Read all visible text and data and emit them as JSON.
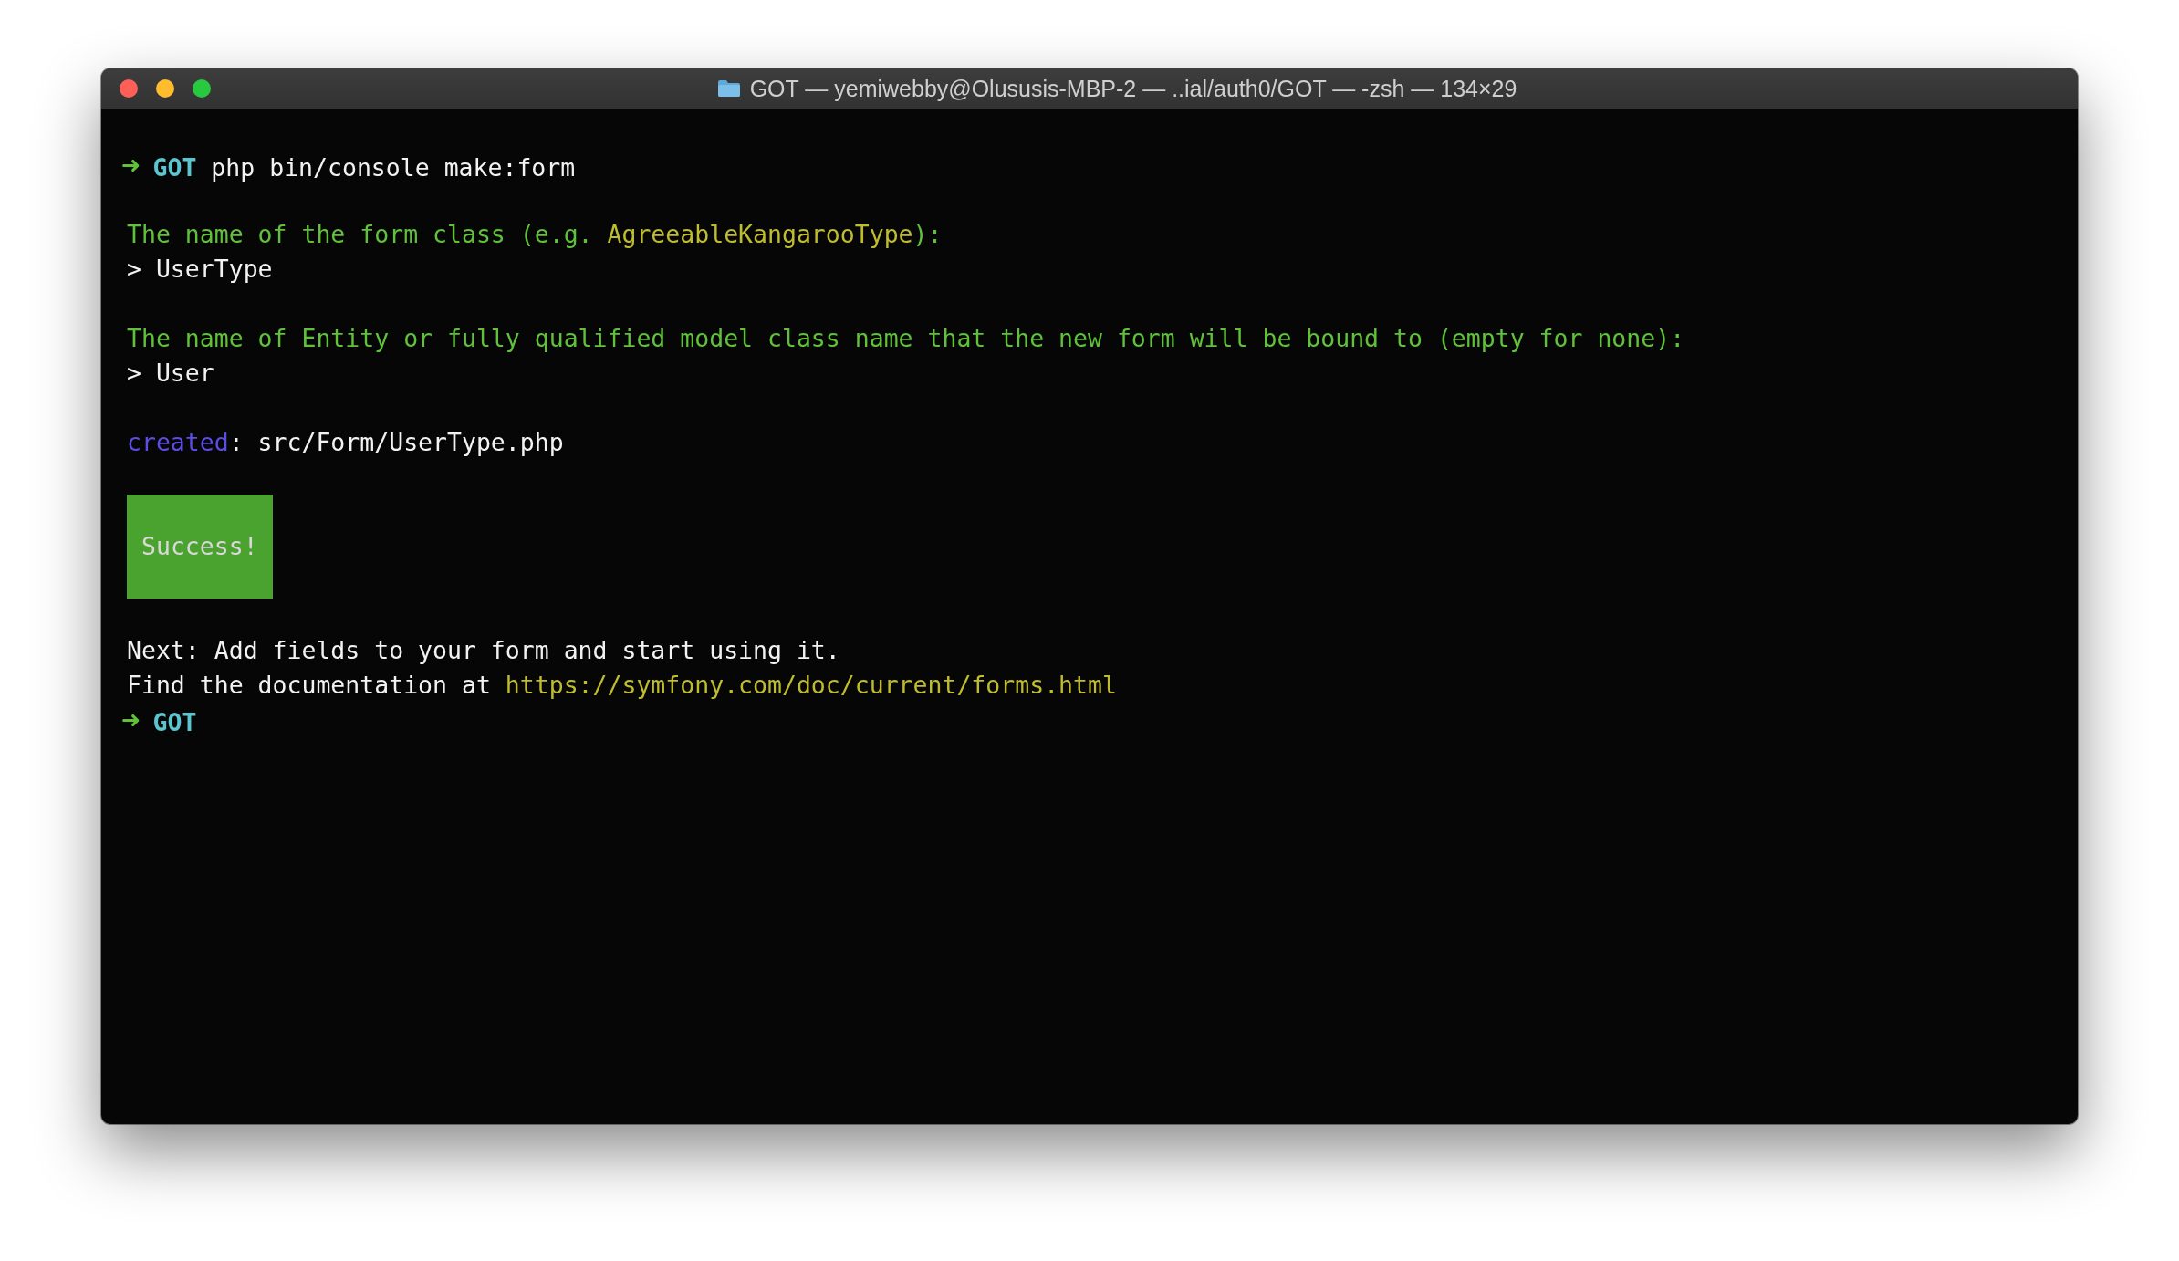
{
  "window": {
    "title": "GOT — yemiwebby@Olususis-MBP-2 — ..ial/auth0/GOT — -zsh — 134×29"
  },
  "lines": [
    {
      "kind": "prompt",
      "symbol": "➜",
      "dir": "GOT",
      "command": "php bin/console make:form"
    },
    {
      "kind": "blank"
    },
    {
      "kind": "text",
      "segments": [
        {
          "kind": "question",
          "text": "The name of the form class (e.g. "
        },
        {
          "kind": "highlight",
          "text": "AgreeableKangarooType"
        },
        {
          "kind": "question",
          "text": "):"
        }
      ]
    },
    {
      "kind": "text",
      "segments": [
        {
          "kind": "plain",
          "text": "> UserType"
        }
      ]
    },
    {
      "kind": "blank"
    },
    {
      "kind": "text",
      "segments": [
        {
          "kind": "question",
          "text": "The name of Entity or fully qualified model class name that the new form will be bound to (empty for none):"
        }
      ]
    },
    {
      "kind": "text",
      "segments": [
        {
          "kind": "plain",
          "text": "> User"
        }
      ]
    },
    {
      "kind": "blank"
    },
    {
      "kind": "text",
      "segments": [
        {
          "kind": "label",
          "text": "created"
        },
        {
          "kind": "plain",
          "text": ": src/Form/UserType.php"
        }
      ]
    },
    {
      "kind": "blank"
    },
    {
      "kind": "block",
      "text": "Success!"
    },
    {
      "kind": "blank"
    },
    {
      "kind": "text",
      "segments": [
        {
          "kind": "plain",
          "text": "Next: Add fields to your form and start using it."
        }
      ]
    },
    {
      "kind": "text",
      "segments": [
        {
          "kind": "plain",
          "text": "Find the documentation at "
        },
        {
          "kind": "link",
          "text": "https://symfony.com/doc/current/forms.html"
        }
      ]
    },
    {
      "kind": "prompt",
      "symbol": "➜",
      "dir": "GOT"
    }
  ]
}
